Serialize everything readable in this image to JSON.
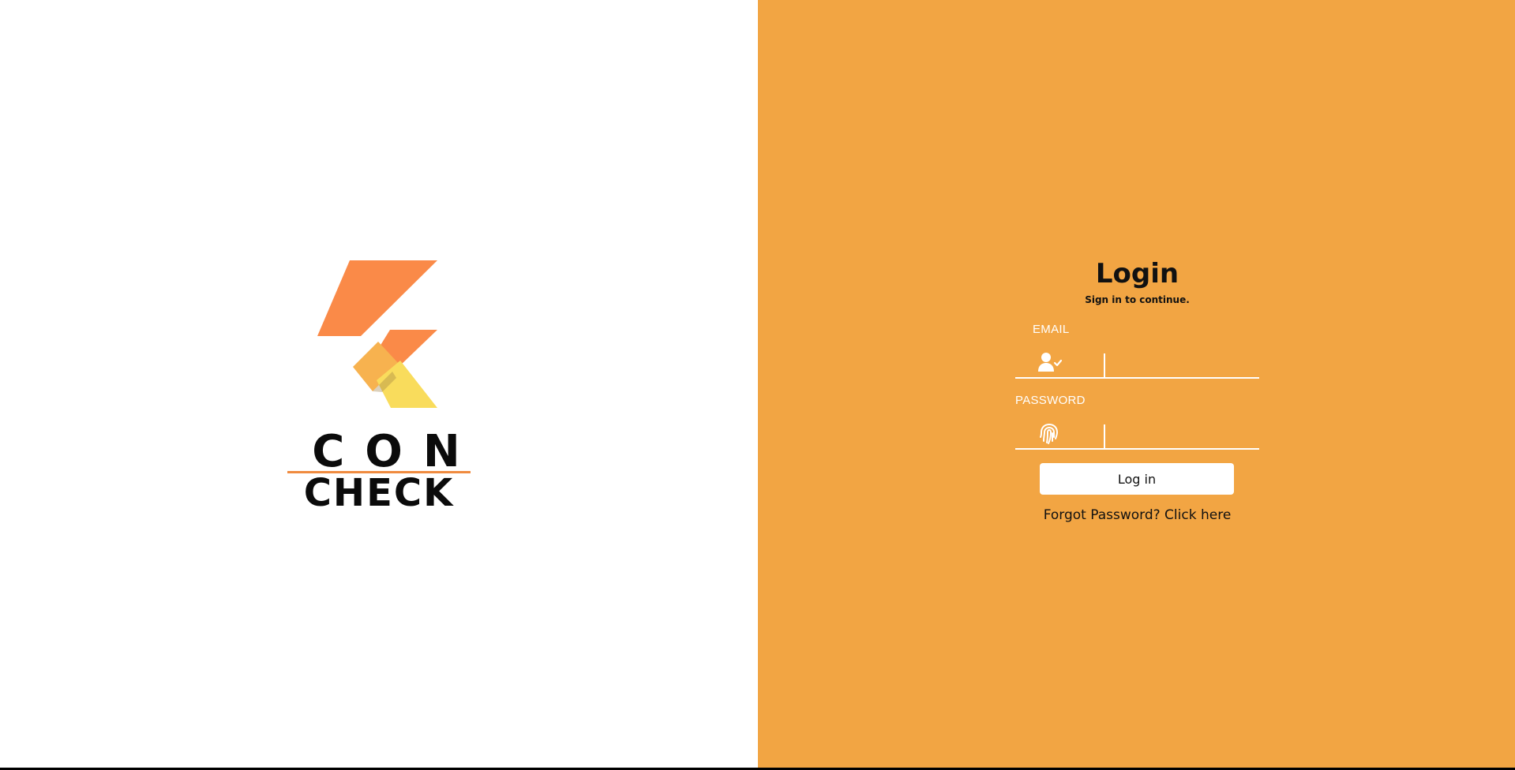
{
  "logo": {
    "line1": "CON",
    "line2": "CHECK"
  },
  "login": {
    "title": "Login",
    "subtitle": "Sign in to continue.",
    "email_label": "EMAIL",
    "email_value": "",
    "password_label": "PASSWORD",
    "password_value": "",
    "submit_label": "Log in",
    "forgot_text": "Forgot Password? Click here"
  },
  "colors": {
    "left_background": "#ffffff",
    "right_background": "#f2a543",
    "button_background": "#ffffff",
    "logo_orange": "#fa8a48",
    "logo_light_orange": "#f7b24f",
    "logo_yellow": "#f9dc5c"
  },
  "icons": {
    "email": "user-check-icon",
    "password": "fingerprint-icon"
  }
}
